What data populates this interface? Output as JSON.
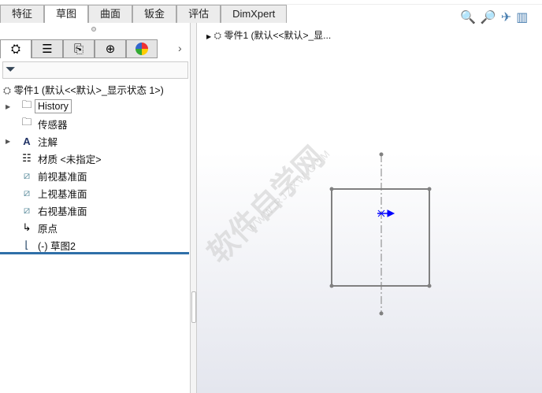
{
  "tabs": [
    "特征",
    "草图",
    "曲面",
    "钣金",
    "评估",
    "DimXpert"
  ],
  "active_tab": 1,
  "panel_tabs": [
    "feature-manager-icon",
    "property-manager-icon",
    "configuration-manager-icon",
    "dimxpert-icon",
    "display-manager-icon"
  ],
  "filter_icon": "funnel-icon",
  "root_label": "零件1  (默认<<默认>_显示状态 1>)",
  "tree": [
    {
      "label": "History",
      "icon": "history-folder-icon",
      "expand": true
    },
    {
      "label": "传感器",
      "icon": "sensor-folder-icon",
      "expand": false
    },
    {
      "label": "注解",
      "icon": "annotation-folder-icon",
      "expand": true
    },
    {
      "label": "材质 <未指定>",
      "icon": "material-icon",
      "expand": false
    },
    {
      "label": "前视基准面",
      "icon": "plane-icon",
      "expand": false
    },
    {
      "label": "上视基准面",
      "icon": "plane-icon",
      "expand": false
    },
    {
      "label": "右视基准面",
      "icon": "plane-icon",
      "expand": false
    },
    {
      "label": "原点",
      "icon": "origin-icon",
      "expand": false
    },
    {
      "label": "(-) 草图2",
      "icon": "sketch-icon",
      "expand": false
    }
  ],
  "viewport": {
    "title": "零件1  (默认<<默认>_显...",
    "watermark": "软件自学网",
    "watermark_url": "WWW.RJZXW.COM"
  },
  "colors": {
    "accent": "#2f6fa8",
    "sketch": "#808080",
    "origin": "#0000ff"
  }
}
